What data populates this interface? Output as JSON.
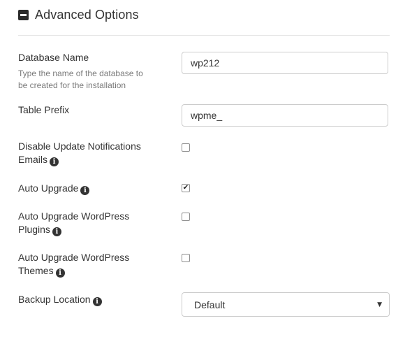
{
  "header": {
    "title": "Advanced Options",
    "icon": "collapse-minus-icon"
  },
  "fields": {
    "database_name": {
      "label": "Database Name",
      "help_line1": "Type the name of the database to",
      "help_line2": "be created for the installation",
      "value": "wp212"
    },
    "table_prefix": {
      "label": "Table Prefix",
      "value": "wpme_"
    },
    "disable_update_notifications": {
      "label_line1": "Disable Update Notifications",
      "label_line2": "Emails",
      "checked": false
    },
    "auto_upgrade": {
      "label": "Auto Upgrade",
      "checked": true
    },
    "auto_upgrade_plugins": {
      "label_line1": "Auto Upgrade WordPress",
      "label_line2": "Plugins",
      "checked": false
    },
    "auto_upgrade_themes": {
      "label_line1": "Auto Upgrade WordPress",
      "label_line2": "Themes",
      "checked": false
    },
    "backup_location": {
      "label": "Backup Location",
      "selected": "Default"
    }
  },
  "glyphs": {
    "info": "i",
    "check": "✔",
    "caret": "▼"
  }
}
